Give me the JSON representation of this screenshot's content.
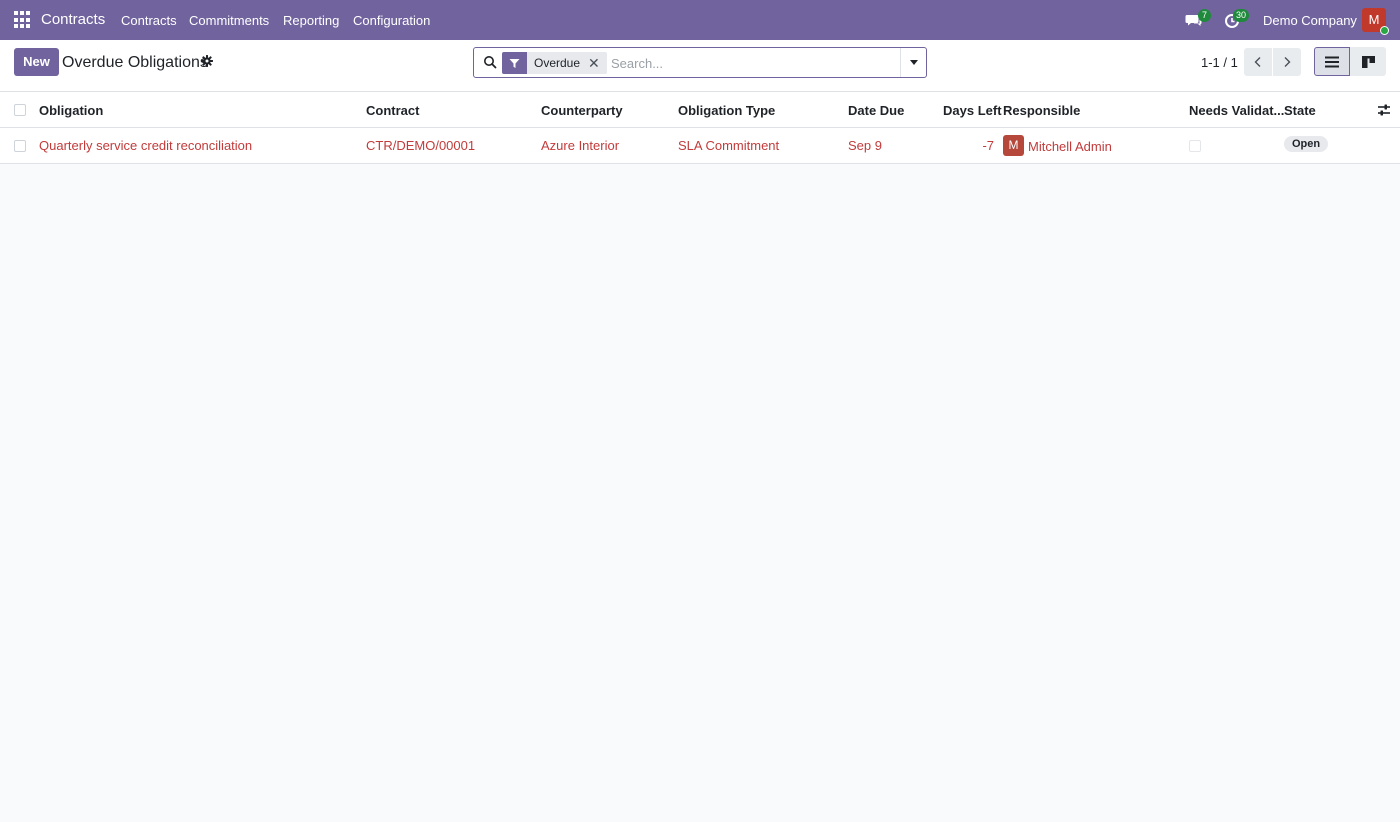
{
  "navbar": {
    "app_name": "Contracts",
    "menus": [
      "Contracts",
      "Commitments",
      "Reporting",
      "Configuration"
    ],
    "messages_count": "7",
    "activities_count": "30",
    "company": "Demo Company",
    "user_initial": "M"
  },
  "control_panel": {
    "new_label": "New",
    "title": "Overdue Obligations",
    "search": {
      "facet_label": "Overdue",
      "placeholder": "Search..."
    },
    "pager": "1-1 / 1"
  },
  "list": {
    "columns": [
      "Obligation",
      "Contract",
      "Counterparty",
      "Obligation Type",
      "Date Due",
      "Days Left",
      "Responsible",
      "Needs Validat...",
      "State"
    ],
    "rows": [
      {
        "obligation": "Quarterly service credit reconciliation",
        "contract": "CTR/DEMO/00001",
        "counterparty": "Azure Interior",
        "obligation_type": "SLA Commitment",
        "date_due": "Sep 9",
        "days_left": "-7",
        "responsible_initial": "M",
        "responsible": "Mitchell Admin",
        "state": "Open"
      }
    ]
  },
  "colors": {
    "brand": "#71639e",
    "link": "#c23b3b",
    "status_ok": "#1f8a3b"
  },
  "icons": [
    "apps-grid-icon",
    "chat-icon",
    "activity-clock-icon",
    "gear-icon",
    "search-icon",
    "filter-icon",
    "close-icon",
    "caret-down-icon",
    "chevron-left-icon",
    "chevron-right-icon",
    "list-view-icon",
    "kanban-view-icon",
    "optional-columns-icon"
  ]
}
